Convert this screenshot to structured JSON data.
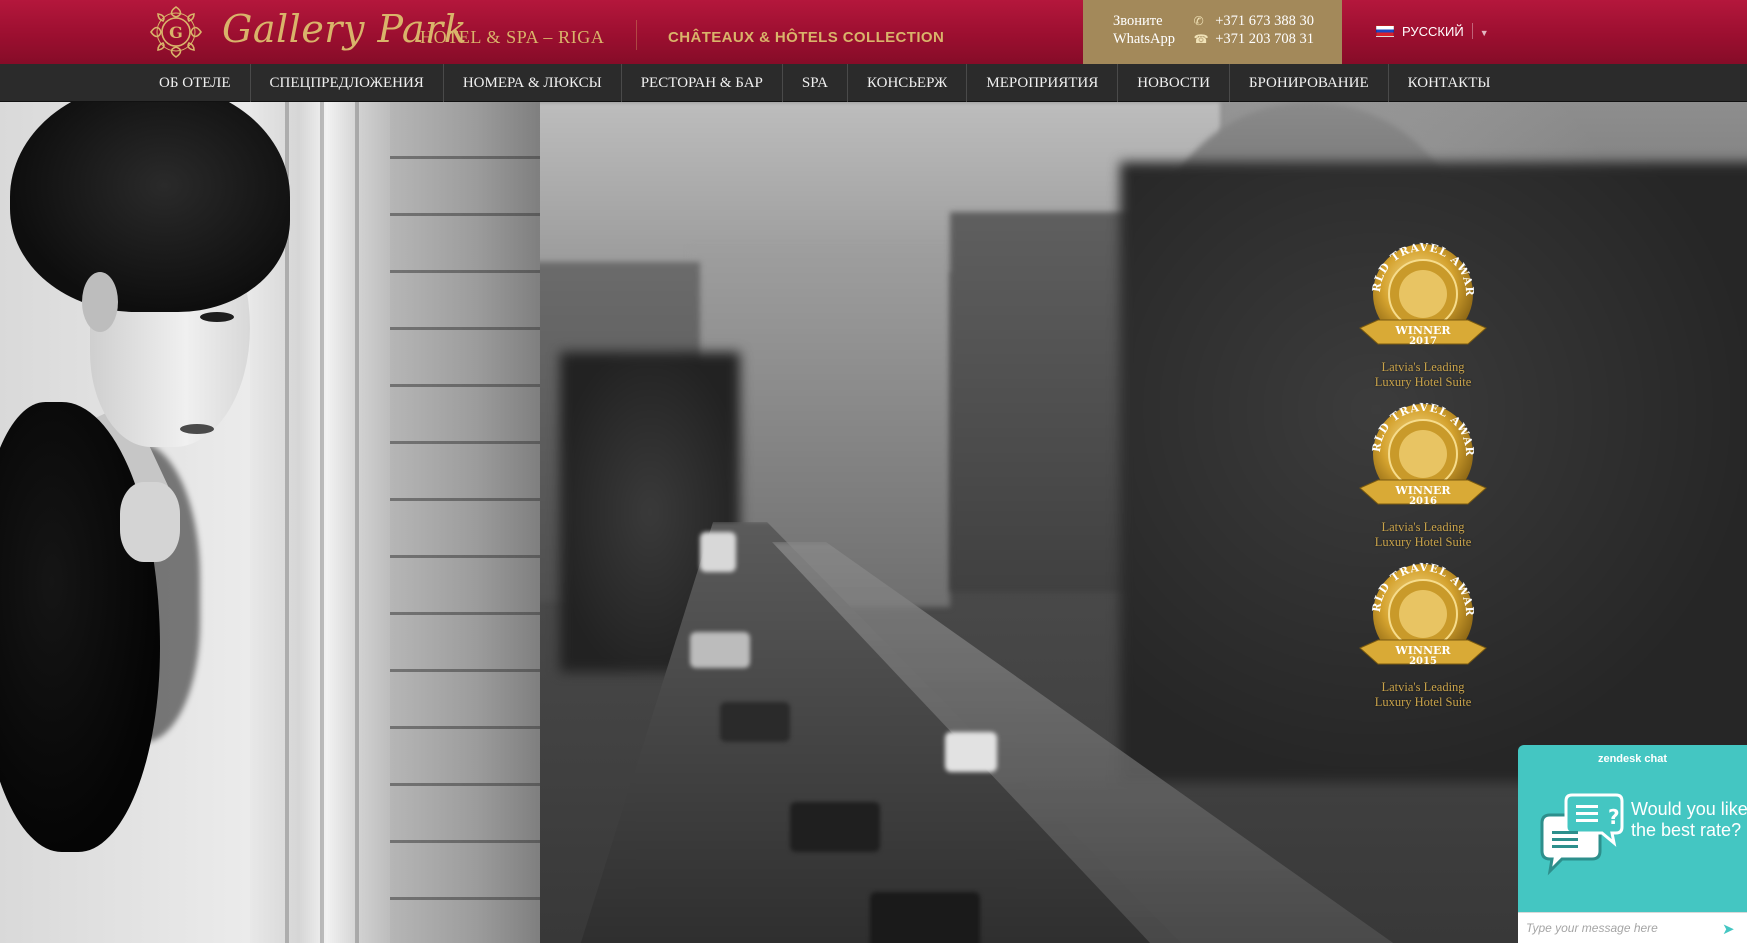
{
  "header": {
    "brand_name": "Gallery Park",
    "brand_subtitle": "HOTEL & SPA – RIGA",
    "logo_letter": "G",
    "collection": "CHÂTEAUX & HÔTELS COLLECTION",
    "contacts": [
      {
        "label": "Звоните",
        "icon": "phone-icon",
        "value": "+371 673 388 30"
      },
      {
        "label": "WhatsApp",
        "icon": "whatsapp-icon",
        "value": "+371 203 708 31"
      }
    ],
    "language": {
      "label": "РУССКИЙ",
      "flag": "russia-flag"
    }
  },
  "nav": {
    "items": [
      "ОБ ОТЕЛЕ",
      "СПЕЦПРЕДЛОЖЕНИЯ",
      "НОМЕРА & ЛЮКСЫ",
      "РЕСТОРАН & БАР",
      "SPA",
      "КОНСЬЕРЖ",
      "МЕРОПРИЯТИЯ",
      "НОВОСТИ",
      "БРОНИРОВАНИЕ",
      "КОНТАКТЫ"
    ]
  },
  "awards": [
    {
      "arc": "WORLD TRAVEL AWARDS",
      "ribbon": "WINNER",
      "year": "2017",
      "line1": "Latvia's Leading",
      "line2": "Luxury Hotel Suite"
    },
    {
      "arc": "WORLD TRAVEL AWARDS",
      "ribbon": "WINNER",
      "year": "2016",
      "line1": "Latvia's Leading",
      "line2": "Luxury Hotel Suite"
    },
    {
      "arc": "WORLD TRAVEL AWARDS",
      "ribbon": "WINNER",
      "year": "2015",
      "line1": "Latvia's Leading",
      "line2": "Luxury Hotel Suite"
    }
  ],
  "chat": {
    "brand": "zendesk chat",
    "message": "Would you like the best rate?",
    "placeholder": "Type your message here"
  },
  "colors": {
    "header_red": "#9c0f30",
    "gold": "#d9b46a",
    "contact_bg": "#a3895a",
    "nav_bg": "#2b2b2b",
    "chat_teal": "#44c6c2"
  }
}
